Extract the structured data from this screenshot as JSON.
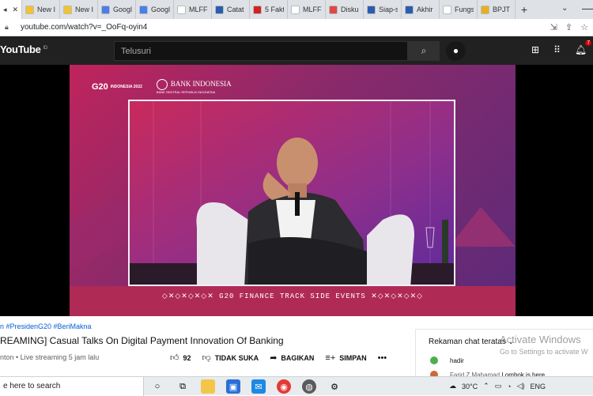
{
  "tabs": [
    {
      "label": "",
      "active": true,
      "fav": "#ffffff"
    },
    {
      "label": "New I",
      "fav": "#f2c230"
    },
    {
      "label": "New I",
      "fav": "#f2c230"
    },
    {
      "label": "Googl",
      "fav": "#4a7ee8"
    },
    {
      "label": "Googl",
      "fav": "#4a7ee8"
    },
    {
      "label": "MLFF",
      "fav": "#ffffff"
    },
    {
      "label": "Catat",
      "fav": "#2a5db0"
    },
    {
      "label": "5 Fakt",
      "fav": "#d02424"
    },
    {
      "label": "MLFF",
      "fav": "#ffffff"
    },
    {
      "label": "Disku",
      "fav": "#e04848"
    },
    {
      "label": "Siap-s",
      "fav": "#2a5db0"
    },
    {
      "label": "Akhir",
      "fav": "#2a5db0"
    },
    {
      "label": "Fungs",
      "fav": "#ffffff"
    },
    {
      "label": "BPJT",
      "fav": "#e8b020"
    }
  ],
  "address": {
    "url": "youtube.com/watch?v=_OoFq-oyin4"
  },
  "youtube": {
    "logo": "YouTube",
    "country": "ID",
    "search_placeholder": "Telusuri",
    "notification_count": "7"
  },
  "video": {
    "g20": "G20",
    "g20_sub": "INDONESIA 2022",
    "bank": "BANK INDONESIA",
    "bank_sub": "BANK SENTRAL REPUBLIK INDONESIA",
    "banner": "◇✕◇✕◇✕◇✕ G20 FINANCE TRACK SIDE EVENTS ✕◇✕◇✕◇✕◇"
  },
  "info": {
    "hashtags": "n #PresidenG20 #BeriMakna",
    "title": "REAMING] Casual Talks On Digital Payment Innovation Of Banking",
    "meta": "nton • Live streaming 5 jam lalu",
    "like_count": "92",
    "dislike_label": "TIDAK SUKA",
    "share_label": "BAGIKAN",
    "save_label": "SIMPAN"
  },
  "chat": {
    "header": "Rekaman chat teratas",
    "msg1": "hadir",
    "msg2_author": "Farid Z Mahamad",
    "msg2": "Lombok is here"
  },
  "watermark": {
    "line1": "Activate Windows",
    "line2": "Go to Settings to activate W"
  },
  "taskbar": {
    "search": "e here to search",
    "temp": "30°C",
    "lang": "ENG"
  }
}
